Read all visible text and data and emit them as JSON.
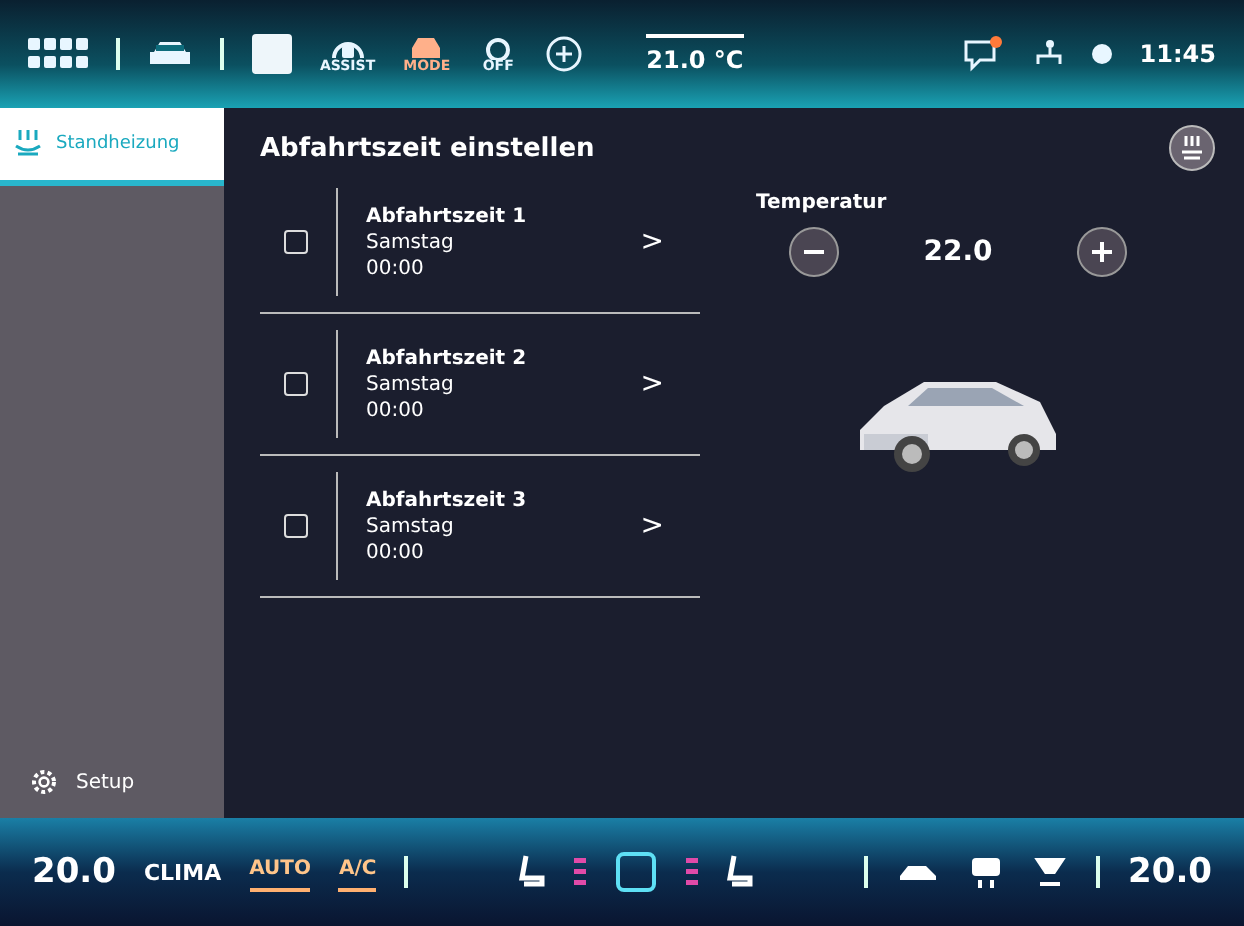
{
  "top_bar": {
    "mode_buttons": [
      {
        "label": "ASSIST",
        "kind": "assist"
      },
      {
        "label": "MODE",
        "kind": "mode"
      },
      {
        "label": "OFF",
        "kind": "off"
      }
    ],
    "temperature": "21.0 °C",
    "notification": true,
    "time": "11:45"
  },
  "sidebar": {
    "items": [
      {
        "label": "Standheizung",
        "selected": true
      }
    ],
    "setup": "Setup"
  },
  "main": {
    "title": "Abfahrtszeit einstellen",
    "departures": [
      {
        "name": "Abfahrtszeit 1",
        "day": "Samstag",
        "time": "00:00",
        "checked": false,
        "chevron": ">"
      },
      {
        "name": "Abfahrtszeit 2",
        "day": "Samstag",
        "time": "00:00",
        "checked": false,
        "chevron": ">"
      },
      {
        "name": "Abfahrtszeit 3",
        "day": "Samstag",
        "time": "00:00",
        "checked": false,
        "chevron": ">"
      }
    ],
    "temperature": {
      "label": "Temperatur",
      "value": "22.0"
    }
  },
  "climate_bar": {
    "left_temperature": "20.0",
    "clima": "CLIMA",
    "toggles": [
      {
        "label": "AUTO",
        "on": true
      },
      {
        "label": "A/C",
        "on": true
      }
    ],
    "right_temperature": "20.0"
  }
}
